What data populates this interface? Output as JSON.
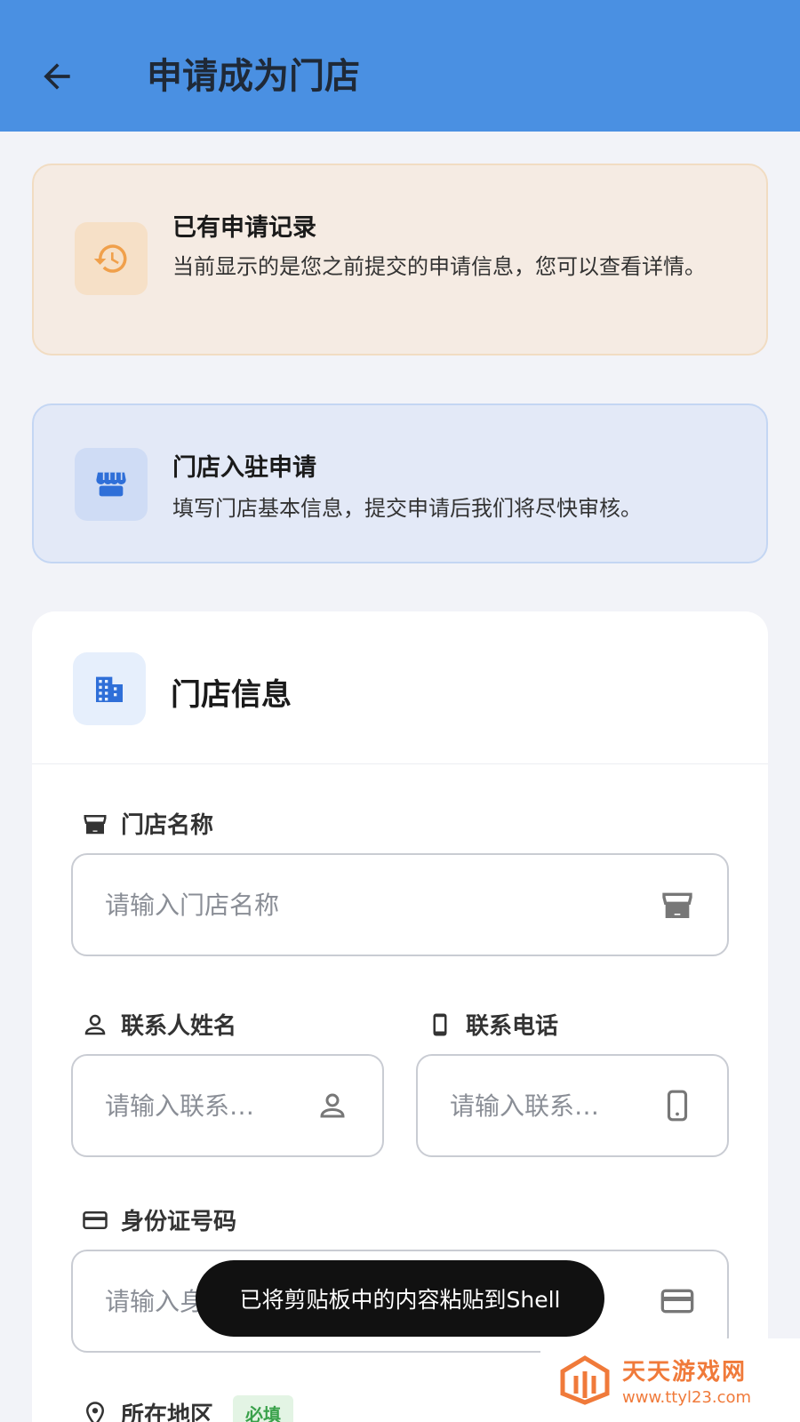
{
  "header": {
    "title": "申请成为门店"
  },
  "history_notice": {
    "title": "已有申请记录",
    "description": "当前显示的是您之前提交的申请信息，您可以查看详情。"
  },
  "apply_notice": {
    "title": "门店入驻申请",
    "description": "填写门店基本信息，提交申请后我们将尽快审核。"
  },
  "store_info": {
    "title": "门店信息",
    "store_name": {
      "label": "门店名称",
      "placeholder": "请输入门店名称"
    },
    "contact_name": {
      "label": "联系人姓名",
      "placeholder": "请输入联系…"
    },
    "contact_phone": {
      "label": "联系电话",
      "placeholder": "请输入联系…"
    },
    "id_number": {
      "label": "身份证号码",
      "placeholder": "请输入身份证号码"
    },
    "region": {
      "label": "所在地区",
      "badge": "必填"
    }
  },
  "toast": {
    "message": "已将剪贴板中的内容粘贴到Shell"
  },
  "watermark": {
    "name": "天天游戏网",
    "url": "www.ttyl23.com"
  },
  "colors": {
    "header_bg": "#4a90e2",
    "history_accent": "#f0a04b",
    "apply_accent": "#2f6fd8",
    "required_green": "#3aa14b"
  }
}
